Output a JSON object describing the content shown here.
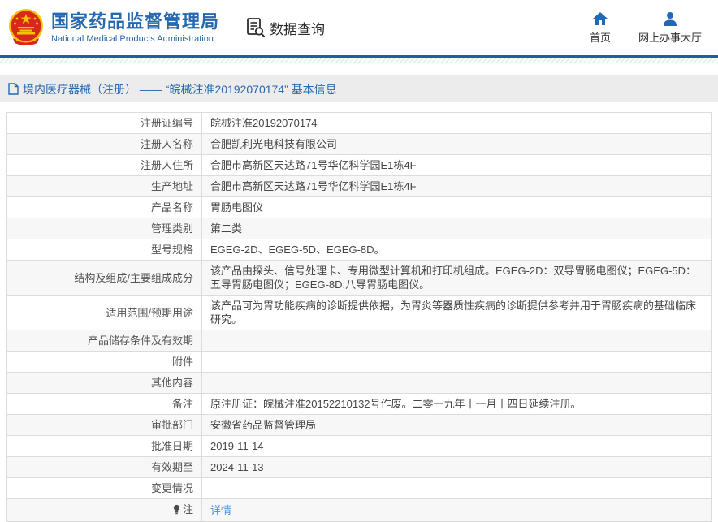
{
  "header": {
    "title": "国家药品监督管理局",
    "subtitle": "National Medical Products Administration",
    "nav_query_label": "数据查询",
    "links": [
      {
        "label": "首页",
        "icon": "home-icon"
      },
      {
        "label": "网上办事大厅",
        "icon": "user-icon"
      }
    ]
  },
  "breadcrumb": {
    "text": "境内医疗器械（注册） ——  “皖械注准20192070174”  基本信息"
  },
  "table": {
    "rows": [
      {
        "label": "注册证编号",
        "value": "皖械注准20192070174"
      },
      {
        "label": "注册人名称",
        "value": "合肥凯利光电科技有限公司"
      },
      {
        "label": "注册人住所",
        "value": "合肥市高新区天达路71号华亿科学园E1栋4F"
      },
      {
        "label": "生产地址",
        "value": "合肥市高新区天达路71号华亿科学园E1栋4F"
      },
      {
        "label": "产品名称",
        "value": "胃肠电图仪"
      },
      {
        "label": "管理类别",
        "value": "第二类"
      },
      {
        "label": "型号规格",
        "value": "EGEG-2D、EGEG-5D、EGEG-8D。"
      },
      {
        "label": "结构及组成/主要组成成分",
        "value": "该产品由探头、信号处理卡、专用微型计算机和打印机组成。EGEG-2D：双导胃肠电图仪；EGEG-5D：五导胃肠电图仪；EGEG-8D:八导胃肠电图仪。"
      },
      {
        "label": "适用范围/预期用途",
        "value": "该产品可为胃功能疾病的诊断提供依据，为胃炎等器质性疾病的诊断提供参考并用于胃肠疾病的基础临床研究。"
      },
      {
        "label": "产品储存条件及有效期",
        "value": ""
      },
      {
        "label": "附件",
        "value": ""
      },
      {
        "label": "其他内容",
        "value": ""
      },
      {
        "label": "备注",
        "value": "原注册证：皖械注准20152210132号作废。二零一九年十一月十四日延续注册。"
      },
      {
        "label": "审批部门",
        "value": "安徽省药品监督管理局"
      },
      {
        "label": "批准日期",
        "value": "2019-11-14"
      },
      {
        "label": "有效期至",
        "value": "2024-11-13"
      },
      {
        "label": "变更情况",
        "value": ""
      },
      {
        "label": "注",
        "value": "详情",
        "icon": "lightbulb",
        "link": true
      }
    ]
  },
  "colors": {
    "brand_blue": "#2768ae",
    "divider_blue": "#1c5fa8",
    "breadcrumb_bg": "#ececec",
    "link_blue": "#4a90d9",
    "emblem_red": "#d7281c",
    "emblem_gold": "#f5c400"
  }
}
